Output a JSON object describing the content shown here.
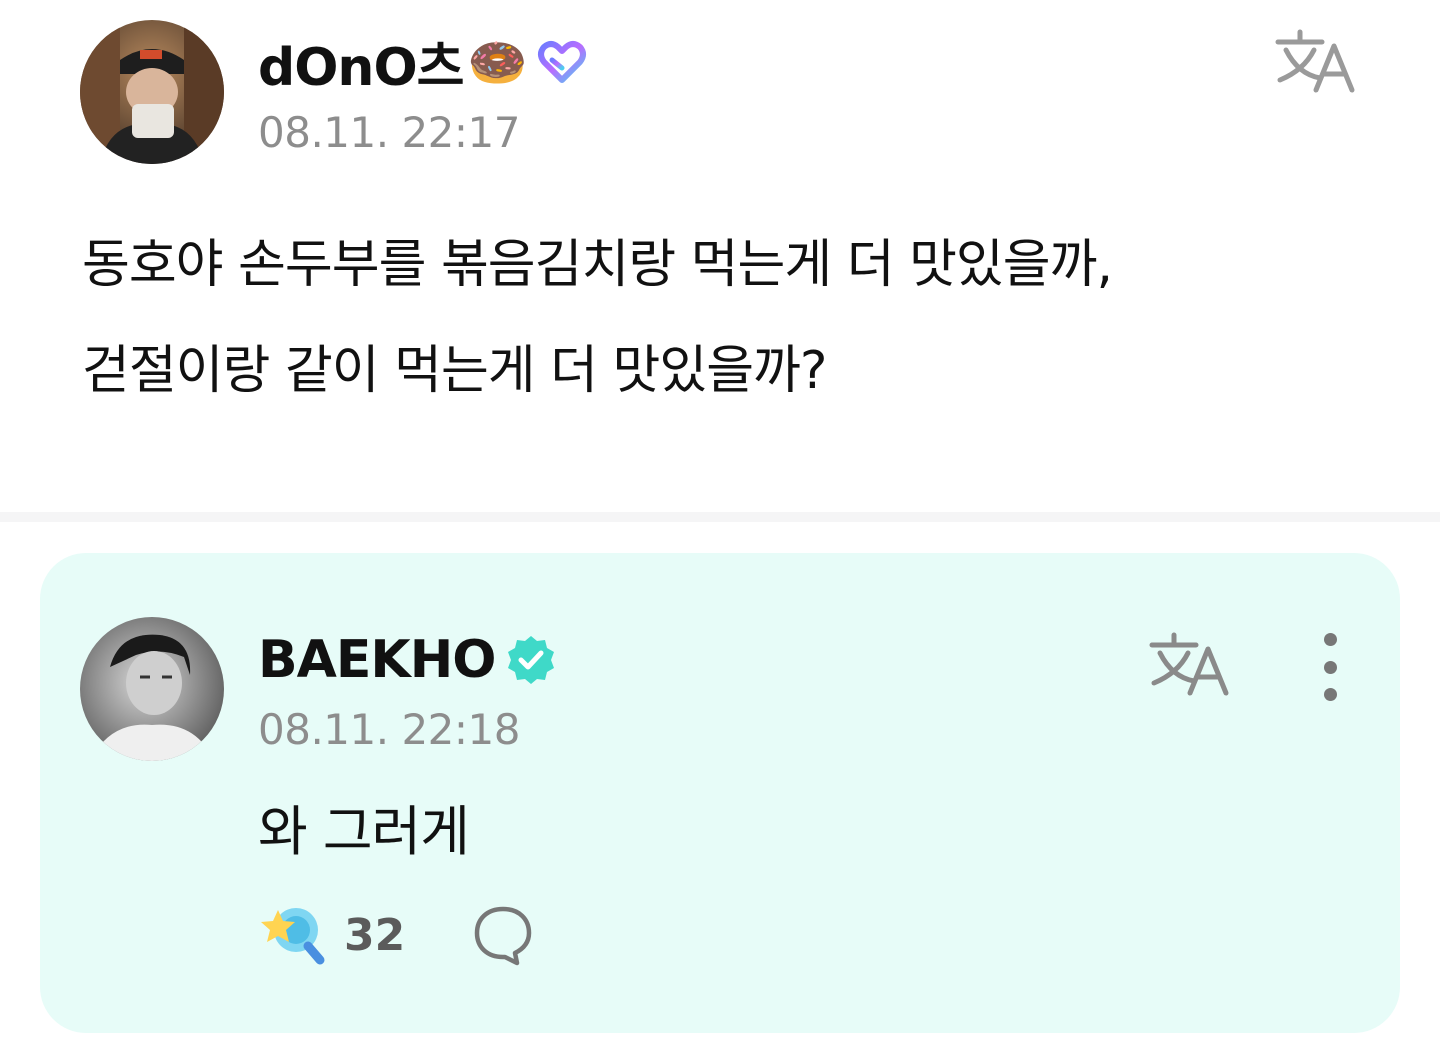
{
  "post": {
    "author": "dOnO츠",
    "author_emoji": "🍩",
    "timestamp": "08.11. 22:17",
    "body": "동호야 손두부를 볶음김치랑 먹는게 더 맛있을까,\n걷절이랑 같이 먹는게 더 맛있을까?",
    "icons": {
      "membership": "heart-badge-icon",
      "translate": "translate-icon"
    }
  },
  "comment": {
    "author": "BAEKHO",
    "timestamp": "08.11. 22:18",
    "text": "와 그러게",
    "like_count": "32",
    "icons": {
      "verified": "verified-badge-icon",
      "translate": "translate-icon",
      "more": "more-vertical-icon",
      "like": "star-wand-icon",
      "reply": "reply-bubble-icon"
    }
  },
  "colors": {
    "comment_background": "#e7fcf8",
    "verified_badge": "#3fd9c8",
    "muted_text": "#8d8d8d"
  }
}
